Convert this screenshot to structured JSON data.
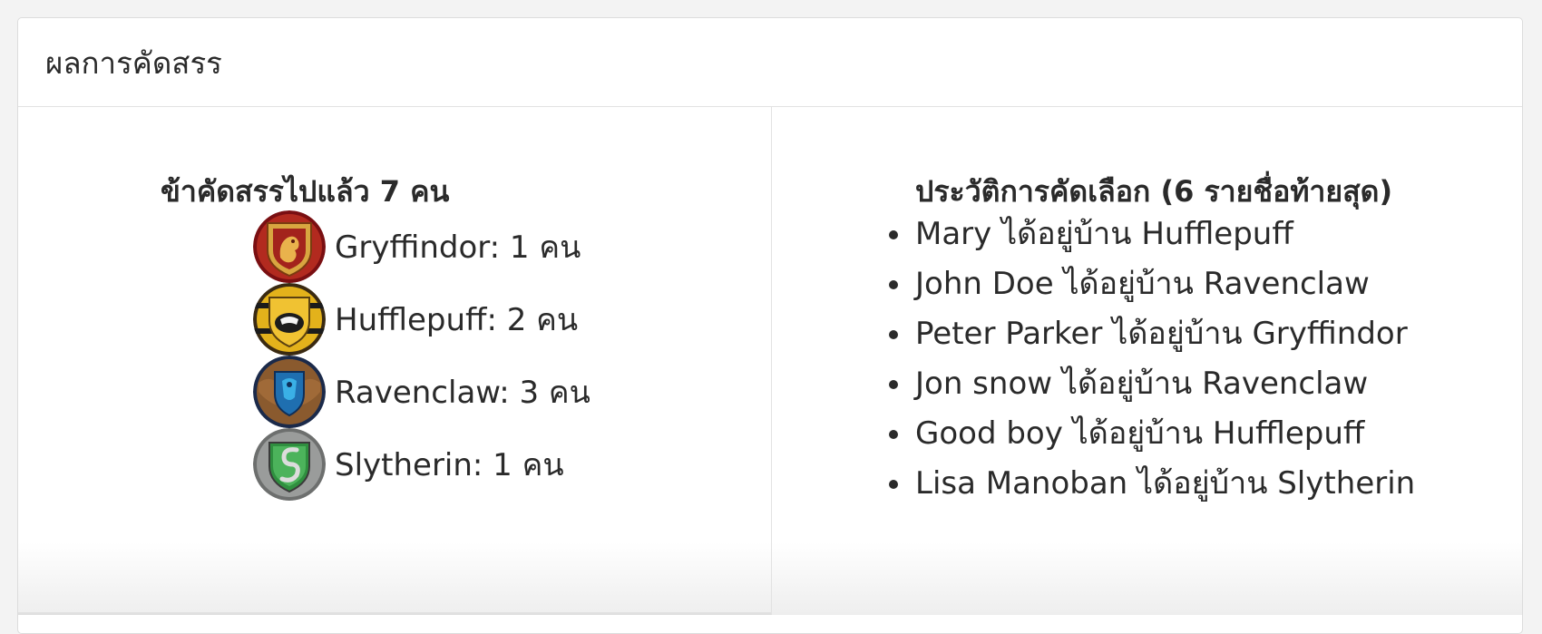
{
  "card": {
    "title": "ผลการคัดสรร"
  },
  "summary": {
    "title": "ข้าคัดสรรไปแล้ว 7 คน",
    "houses": [
      {
        "label": "Gryffindor: 1 คน",
        "icon": "gryffindor-crest-icon",
        "color": "#9b1c1c"
      },
      {
        "label": "Hufflepuff: 2 คน",
        "icon": "hufflepuff-crest-icon",
        "color": "#e3b21b"
      },
      {
        "label": "Ravenclaw: 3 คน",
        "icon": "ravenclaw-crest-icon",
        "color": "#1f6fb0"
      },
      {
        "label": "Slytherin: 1 คน",
        "icon": "slytherin-crest-icon",
        "color": "#2f8f3f"
      }
    ]
  },
  "history": {
    "title": "ประวัติการคัดเลือก (6 รายชื่อท้ายสุด)",
    "items": [
      "Mary ได้อยู่บ้าน Hufflepuff",
      "John Doe ได้อยู่บ้าน Ravenclaw",
      "Peter Parker ได้อยู่บ้าน Gryffindor",
      "Jon snow ได้อยู่บ้าน Ravenclaw",
      "Good boy ได้อยู่บ้าน Hufflepuff",
      "Lisa Manoban ได้อยู่บ้าน Slytherin"
    ]
  }
}
